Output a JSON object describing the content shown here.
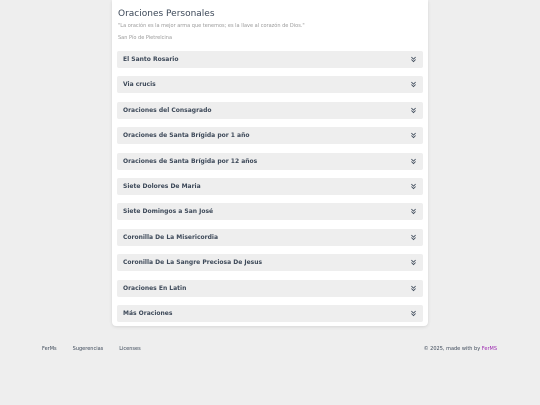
{
  "header": {
    "title": "Oraciones Personales",
    "quote": "\"La oración es la mejor arma que tenemos; es la llave al corazón de Dios.\"",
    "author": "San Pío de Pietrelcina"
  },
  "accordion": {
    "items": [
      {
        "label": "El Santo Rosario",
        "icon": "chevron-double-down-icon"
      },
      {
        "label": "Via crucis",
        "icon": "chevron-double-down-icon"
      },
      {
        "label": "Oraciones del Consagrado",
        "icon": "chevron-double-down-icon"
      },
      {
        "label": "Oraciones de Santa Brígida por 1 año",
        "icon": "chevron-double-down-icon"
      },
      {
        "label": "Oraciones de Santa Brígida por 12 años",
        "icon": "chevron-double-down-icon"
      },
      {
        "label": "Siete Dolores De Maria",
        "icon": "chevron-double-down-icon"
      },
      {
        "label": "Siete Domingos a San José",
        "icon": "chevron-double-down-icon"
      },
      {
        "label": "Coronilla De La Misericordia",
        "icon": "chevron-double-down-icon"
      },
      {
        "label": "Coronilla De La Sangre Preciosa De Jesus",
        "icon": "chevron-double-down-icon"
      },
      {
        "label": "Oraciones En Latin",
        "icon": "chevron-double-down-icon"
      },
      {
        "label": "Más Oraciones",
        "icon": "chevron-double-down-icon"
      }
    ]
  },
  "footer": {
    "links": [
      "FerMs",
      "Sugerencias",
      "Licenses"
    ],
    "copyright": "© 2025, made with by ",
    "brand": "FerMS"
  },
  "colors": {
    "background": "#eeeeee",
    "card": "#ffffff",
    "accordion_item": "#eeeeee",
    "text": "#3c4858",
    "muted": "#999999",
    "brand": "#9c27b0"
  }
}
